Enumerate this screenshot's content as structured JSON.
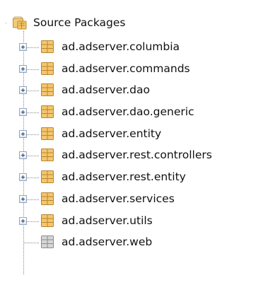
{
  "tree": {
    "root": {
      "label": "Source Packages",
      "icon": "source-packages-folder-icon"
    },
    "packages": [
      {
        "label": "ad.adserver.columbia",
        "expandable": true,
        "icon": "package-icon"
      },
      {
        "label": "ad.adserver.commands",
        "expandable": true,
        "icon": "package-icon"
      },
      {
        "label": "ad.adserver.dao",
        "expandable": true,
        "icon": "package-icon"
      },
      {
        "label": "ad.adserver.dao.generic",
        "expandable": true,
        "icon": "package-icon"
      },
      {
        "label": "ad.adserver.entity",
        "expandable": true,
        "icon": "package-icon"
      },
      {
        "label": "ad.adserver.rest.controllers",
        "expandable": true,
        "icon": "package-icon"
      },
      {
        "label": "ad.adserver.rest.entity",
        "expandable": true,
        "icon": "package-icon"
      },
      {
        "label": "ad.adserver.services",
        "expandable": true,
        "icon": "package-icon"
      },
      {
        "label": "ad.adserver.utils",
        "expandable": true,
        "icon": "package-icon"
      },
      {
        "label": "ad.adserver.web",
        "expandable": false,
        "icon": "empty-package-icon"
      }
    ]
  },
  "colors": {
    "package_fill": "#f3c66f",
    "package_border": "#b8862e",
    "empty_package_fill": "#d6d6d6",
    "empty_package_border": "#8c8c8c",
    "tree_line": "#8a8a8a",
    "text": "#111111"
  }
}
